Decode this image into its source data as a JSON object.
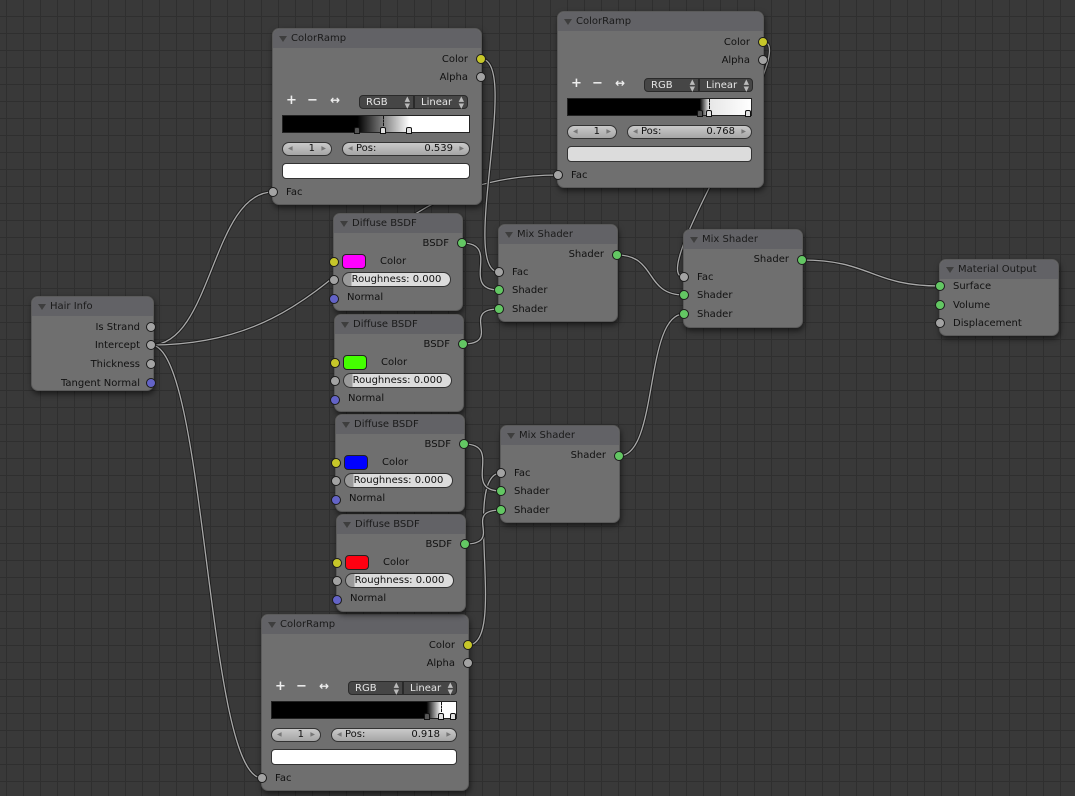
{
  "nodes": {
    "hair_info": {
      "title": "Hair Info",
      "outputs": [
        "Is Strand",
        "Intercept",
        "Thickness",
        "Tangent Normal"
      ]
    },
    "colorramp_top": {
      "title": "ColorRamp",
      "outputs": [
        "Color",
        "Alpha"
      ],
      "add_label": "+",
      "remove_label": "−",
      "flip_label": "↔",
      "color_mode": "RGB",
      "interpolation": "Linear",
      "stops": [
        0.4,
        0.539,
        0.68
      ],
      "active_index": "1",
      "pos_label": "Pos:",
      "pos_value": "0.539",
      "active_color": "#ffffff",
      "input": "Fac"
    },
    "colorramp_right": {
      "title": "ColorRamp",
      "outputs": [
        "Color",
        "Alpha"
      ],
      "add_label": "+",
      "remove_label": "−",
      "flip_label": "↔",
      "color_mode": "RGB",
      "interpolation": "Linear",
      "stops": [
        0.72,
        0.768,
        1.0
      ],
      "active_index": "1",
      "pos_label": "Pos:",
      "pos_value": "0.768",
      "active_color": "#dcdcdc",
      "input": "Fac"
    },
    "colorramp_bottom": {
      "title": "ColorRamp",
      "outputs": [
        "Color",
        "Alpha"
      ],
      "add_label": "+",
      "remove_label": "−",
      "flip_label": "↔",
      "color_mode": "RGB",
      "interpolation": "Linear",
      "stops": [
        0.84,
        0.918,
        1.0
      ],
      "active_index": "1",
      "pos_label": "Pos:",
      "pos_value": "0.918",
      "active_color": "#ffffff",
      "input": "Fac"
    },
    "diffuse": [
      {
        "title": "Diffuse BSDF",
        "output": "BSDF",
        "color_label": "Color",
        "color": "#ff00ff",
        "roughness": "Roughness: 0.000",
        "normal": "Normal"
      },
      {
        "title": "Diffuse BSDF",
        "output": "BSDF",
        "color_label": "Color",
        "color": "#44ff00",
        "roughness": "Roughness: 0.000",
        "normal": "Normal"
      },
      {
        "title": "Diffuse BSDF",
        "output": "BSDF",
        "color_label": "Color",
        "color": "#0000ff",
        "roughness": "Roughness: 0.000",
        "normal": "Normal"
      },
      {
        "title": "Diffuse BSDF",
        "output": "BSDF",
        "color_label": "Color",
        "color": "#ff0011",
        "roughness": "Roughness: 0.000",
        "normal": "Normal"
      }
    ],
    "mix": [
      {
        "title": "Mix Shader",
        "output": "Shader",
        "inputs": [
          "Fac",
          "Shader",
          "Shader"
        ]
      },
      {
        "title": "Mix Shader",
        "output": "Shader",
        "inputs": [
          "Fac",
          "Shader",
          "Shader"
        ]
      },
      {
        "title": "Mix Shader",
        "output": "Shader",
        "inputs": [
          "Fac",
          "Shader",
          "Shader"
        ]
      }
    ],
    "material_output": {
      "title": "Material Output",
      "inputs": [
        "Surface",
        "Volume",
        "Displacement"
      ]
    }
  },
  "colors": {
    "socket_color": "#c7c729",
    "socket_shader": "#63c763",
    "socket_value": "#a3a3a3",
    "socket_vector": "#6363c7"
  },
  "links": [
    [
      "hair_info.Intercept",
      "colorramp_top.Fac"
    ],
    [
      "hair_info.Intercept",
      "colorramp_right.Fac"
    ],
    [
      "hair_info.Intercept",
      "colorramp_bottom.Fac"
    ],
    [
      "colorramp_top.Color",
      "mix_top.Fac"
    ],
    [
      "diffuse_magenta.BSDF",
      "mix_top.Shader1"
    ],
    [
      "diffuse_green.BSDF",
      "mix_top.Shader2"
    ],
    [
      "colorramp_bottom.Color",
      "mix_bottom.Fac"
    ],
    [
      "diffuse_blue.BSDF",
      "mix_bottom.Shader1"
    ],
    [
      "diffuse_red.BSDF",
      "mix_bottom.Shader2"
    ],
    [
      "colorramp_right.Color",
      "mix_final.Fac"
    ],
    [
      "mix_top.Shader",
      "mix_final.Shader1"
    ],
    [
      "mix_bottom.Shader",
      "mix_final.Shader2"
    ],
    [
      "mix_final.Shader",
      "material_output.Surface"
    ]
  ]
}
